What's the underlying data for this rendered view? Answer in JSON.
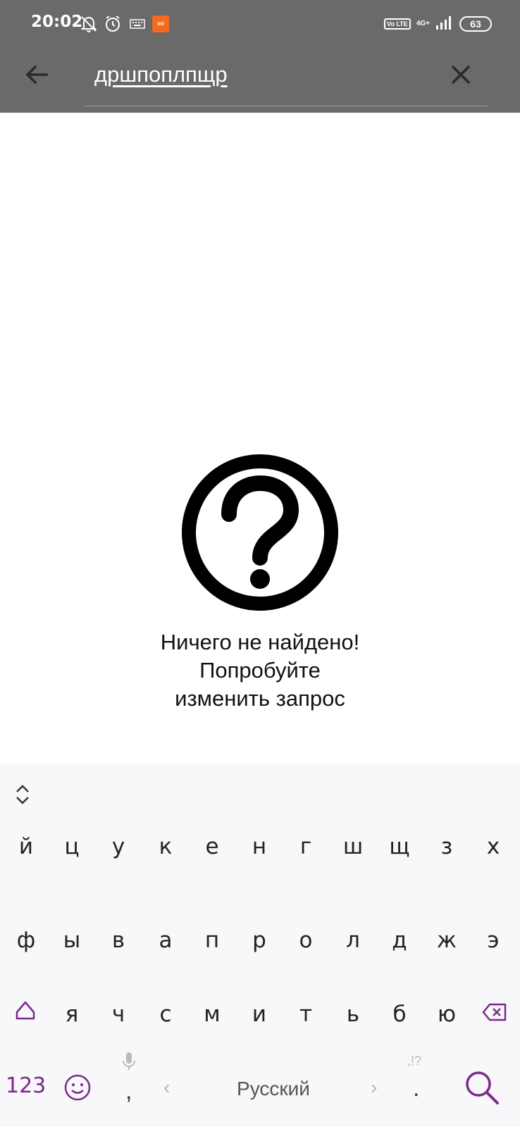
{
  "status_bar": {
    "time": "20:02",
    "icons": [
      "muted-bell-icon",
      "alarm-icon",
      "keyboard-icon",
      "xiaomi-app-icon",
      "volte-icon",
      "signal-4g-icon",
      "battery-icon"
    ],
    "volte": "Vo LTE",
    "network": "4G+",
    "battery": "63",
    "xiaomi_badge": "mi"
  },
  "search_bar": {
    "query": "дршпоплпщр",
    "back_icon": "arrow-left-icon",
    "clear_icon": "close-icon"
  },
  "empty_state": {
    "icon": "help-circle-icon",
    "line1": "Ничего не найдено!",
    "line2": "Попробуйте",
    "line3": "изменить запрос"
  },
  "keyboard": {
    "row1": [
      "й",
      "ц",
      "у",
      "к",
      "е",
      "н",
      "г",
      "ш",
      "щ",
      "з",
      "х"
    ],
    "row2": [
      "ф",
      "ы",
      "в",
      "а",
      "п",
      "р",
      "о",
      "л",
      "д",
      "ж",
      "э"
    ],
    "row3": [
      "я",
      "ч",
      "с",
      "м",
      "и",
      "т",
      "ь",
      "б",
      "ю"
    ],
    "num_key": "123",
    "comma": ",",
    "arrow_left": "‹",
    "language": "Русский",
    "arrow_right": "›",
    "punct_hint": ",!?",
    "period": ".",
    "accent_color": "#7a2a8a"
  }
}
